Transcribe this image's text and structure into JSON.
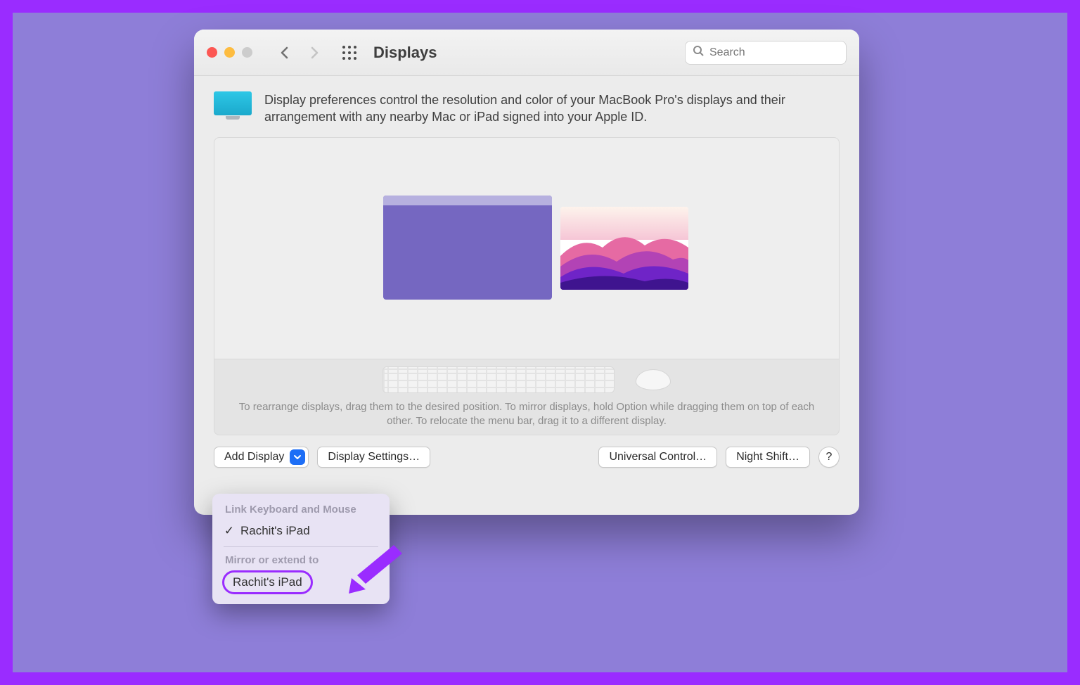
{
  "window": {
    "title": "Displays",
    "search_placeholder": "Search"
  },
  "intro": "Display preferences control the resolution and color of your MacBook Pro's displays and their arrangement with any nearby Mac or iPad signed into your Apple ID.",
  "hint": "To rearrange displays, drag them to the desired position. To mirror displays, hold Option while dragging them on top of each other. To relocate the menu bar, drag it to a different display.",
  "buttons": {
    "add_display": "Add Display",
    "display_settings": "Display Settings…",
    "universal_control": "Universal Control…",
    "night_shift": "Night Shift…",
    "help": "?"
  },
  "dropdown": {
    "section1_title": "Link Keyboard and Mouse",
    "item1_label": "Rachit's iPad",
    "section2_title": "Mirror or extend to",
    "item2_label": "Rachit's iPad"
  }
}
